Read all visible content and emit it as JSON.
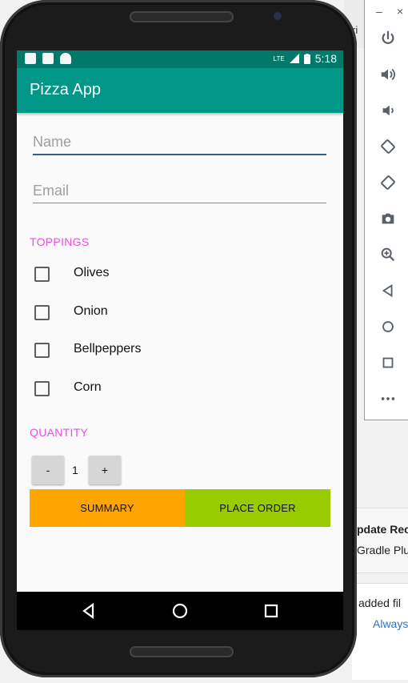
{
  "ide": {
    "partial_top_text": "ri",
    "notification_title": "pdate Rec",
    "notification_body": "Gradle Plug",
    "bottom_text": "added fil",
    "link_text": "Always"
  },
  "emulator_toolbar": {
    "minimize": "–",
    "close": "×",
    "tools": [
      "power-icon",
      "volume-up-icon",
      "volume-down-icon",
      "rotate-left-icon",
      "rotate-right-icon",
      "camera-icon",
      "zoom-icon",
      "back-icon",
      "home-icon",
      "overview-icon",
      "more-icon"
    ]
  },
  "status_bar": {
    "time": "5:18",
    "network": "LTE"
  },
  "app": {
    "title": "Pizza App",
    "name_placeholder": "Name",
    "email_placeholder": "Email",
    "toppings_label": "TOPPINGS",
    "toppings": [
      "Olives",
      "Onion",
      "Bellpeppers",
      "Corn"
    ],
    "quantity_label": "QUANTITY",
    "minus_label": "-",
    "quantity_value": "1",
    "plus_label": "+",
    "summary_label": "SUMMARY",
    "place_order_label": "PLACE ORDER"
  },
  "colors": {
    "status_bar": "#00796b",
    "app_bar": "#009688",
    "section_label": "#e551e0",
    "summary_button": "#ffa500",
    "place_order_button": "#99cc00"
  }
}
